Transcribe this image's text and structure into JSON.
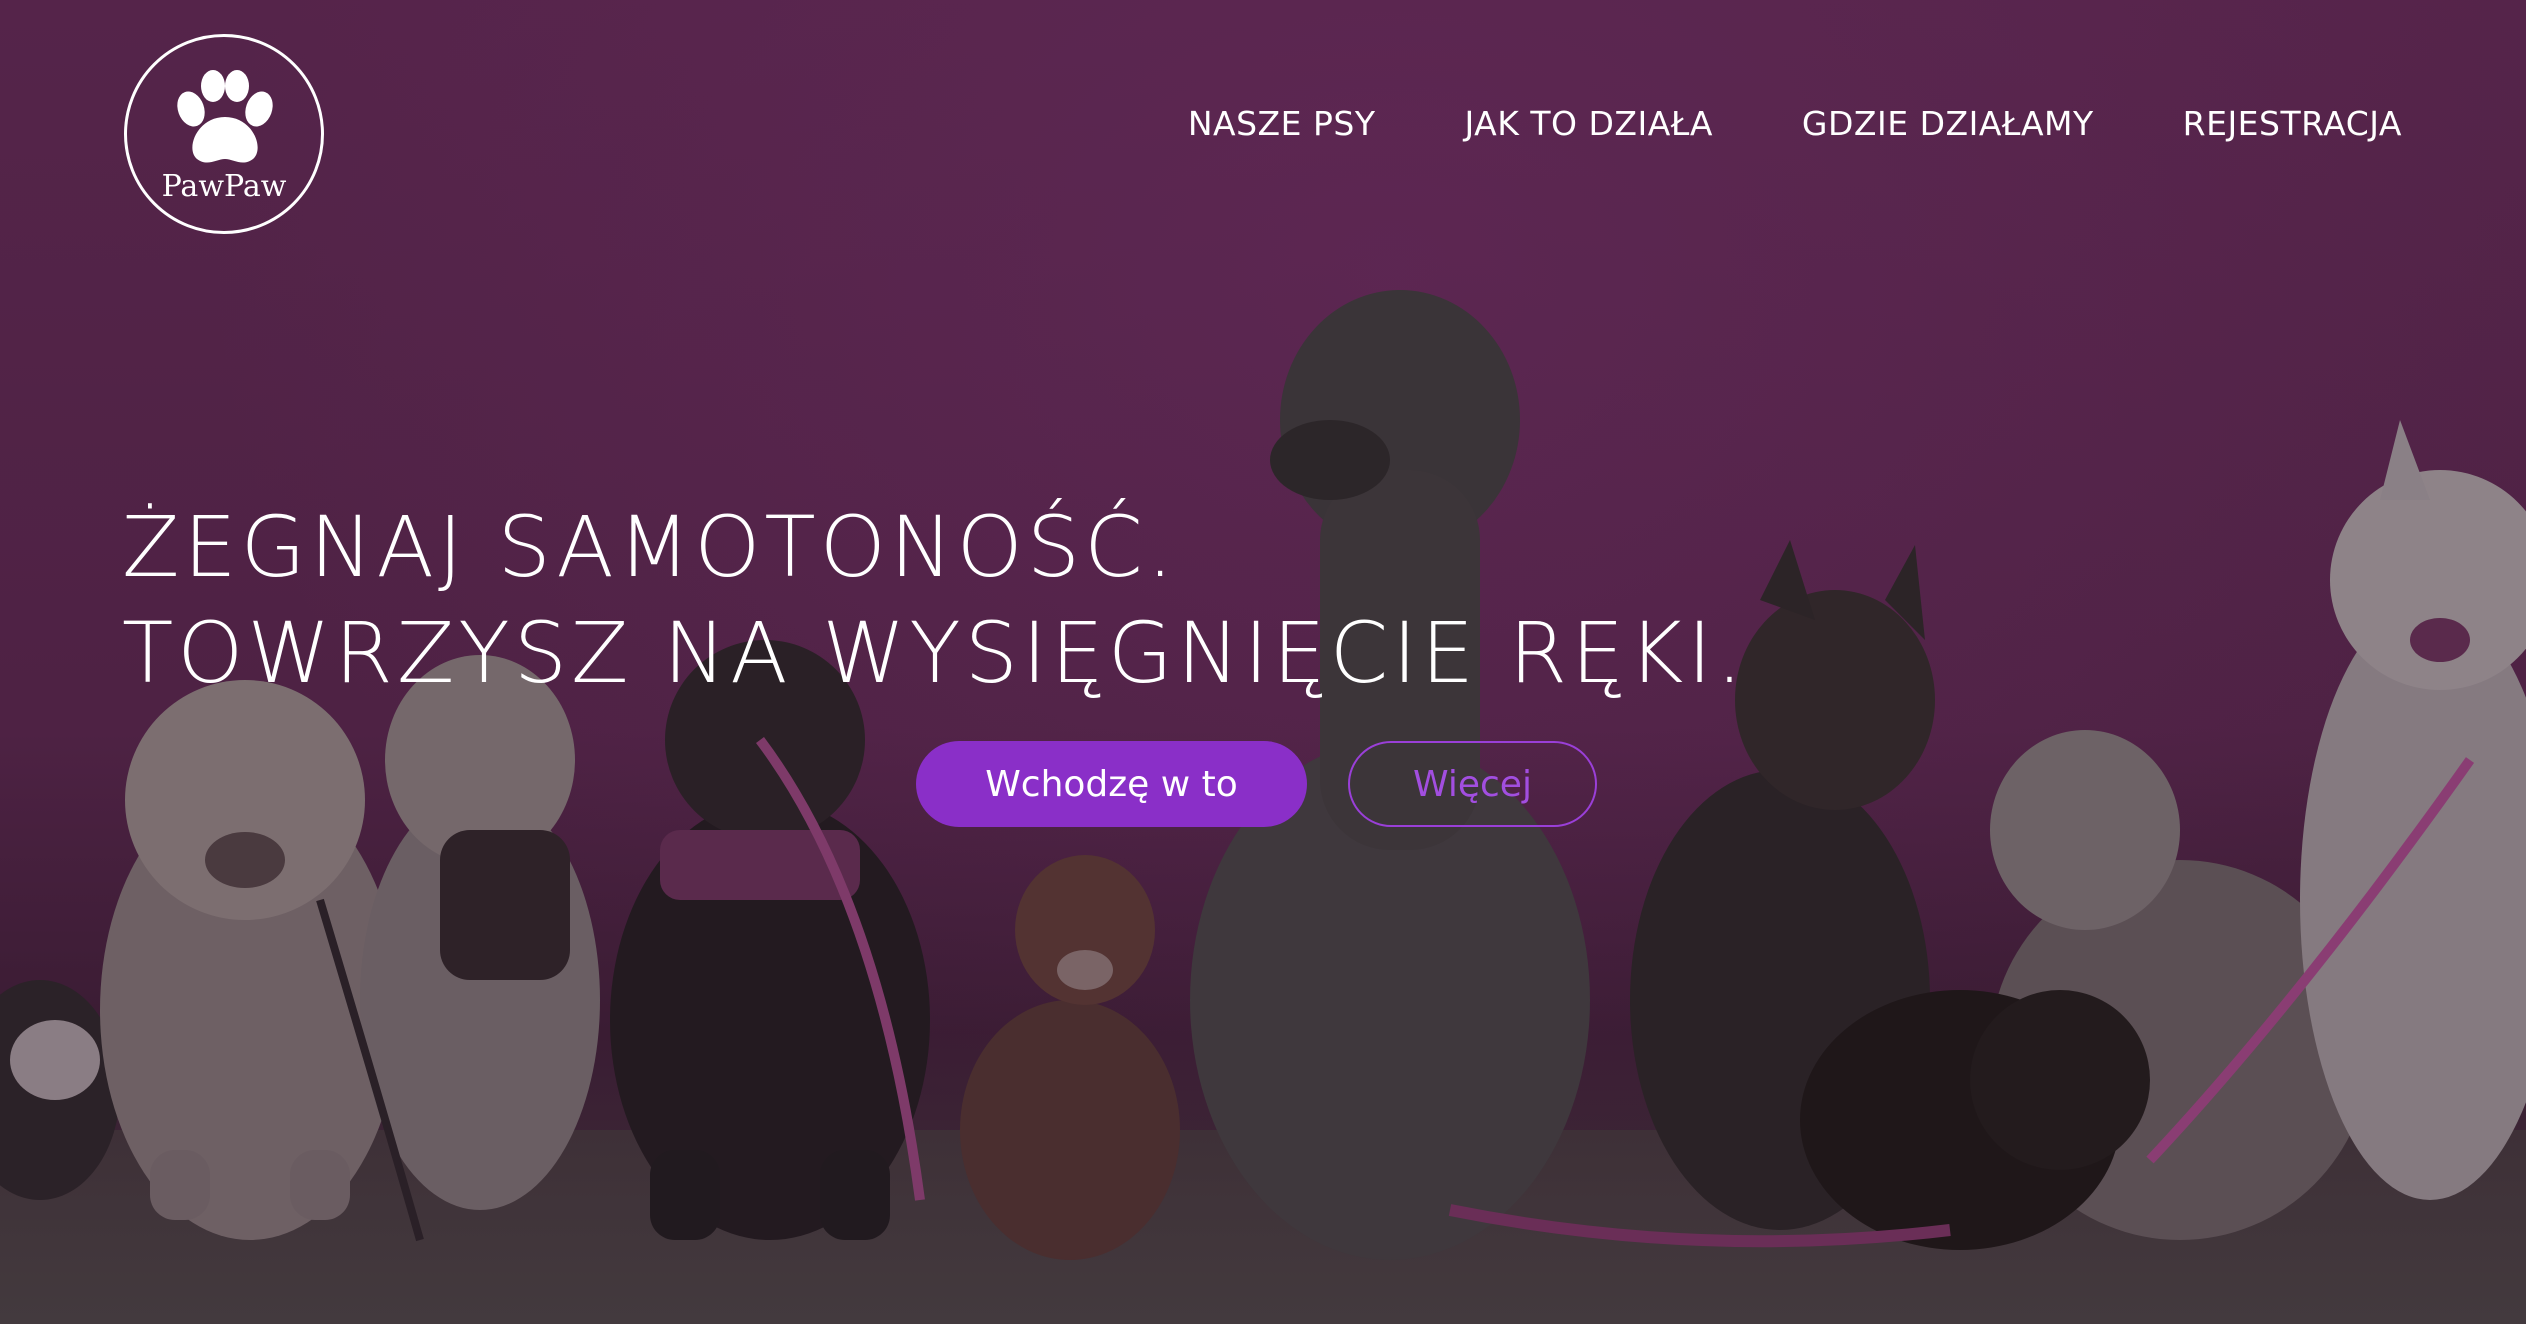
{
  "brand": {
    "name": "PawPaw",
    "icon": "paw-icon"
  },
  "nav": {
    "items": [
      {
        "label": "NASZE PSY"
      },
      {
        "label": "JAK TO DZIAŁA"
      },
      {
        "label": "GDZIE DZIAŁAMY"
      },
      {
        "label": "REJESTRACJA"
      }
    ]
  },
  "hero": {
    "headline_line1": "ŻEGNAJ SAMOTONOŚĆ.",
    "headline_line2": "TOWRZYSZ NA WYSIĘGNIĘCIE RĘKI.",
    "primary_button": "Wchodzę w to",
    "secondary_button": "Więcej"
  },
  "colors": {
    "background": "#4e2244",
    "accent": "#8a2fc8",
    "accent_outline": "#9a3fd8",
    "text": "#ffffff"
  }
}
